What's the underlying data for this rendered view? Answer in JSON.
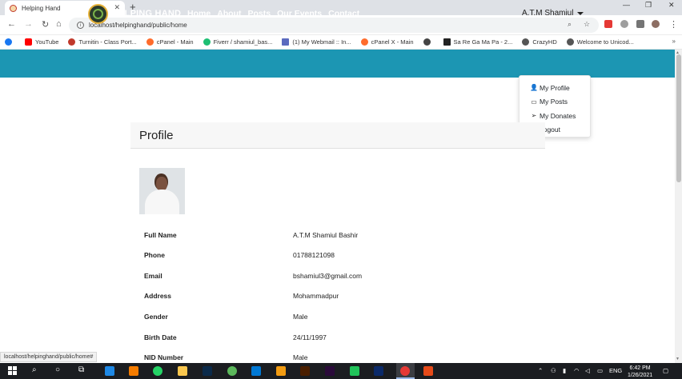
{
  "browser": {
    "tab_title": "Helping Hand",
    "url": "localhost/helpinghand/public/home",
    "status_url": "localhost/helpinghand/public/home#",
    "bookmarks": [
      {
        "label": "",
        "color": "#1877f2"
      },
      {
        "label": "YouTube",
        "color": "#ff0000"
      },
      {
        "label": "Turnitin - Class Port...",
        "color": "#c0392b"
      },
      {
        "label": "cPanel - Main",
        "color": "#ff6c2c"
      },
      {
        "label": "Fiverr / shamiul_bas...",
        "color": "#1dbf73"
      },
      {
        "label": "(1) My Webmail :: In...",
        "color": "#5b6abf"
      },
      {
        "label": "cPanel X - Main",
        "color": "#ff6c2c"
      },
      {
        "label": "",
        "color": "#444444"
      },
      {
        "label": "Sa Re Ga Ma Pa - 2...",
        "color": "#222222"
      },
      {
        "label": "CrazyHD",
        "color": "#555555"
      },
      {
        "label": "Welcome to Unicod...",
        "color": "#555555"
      }
    ]
  },
  "site": {
    "brand": "HELPING HAND",
    "nav": [
      "Home",
      "About",
      "Posts",
      "Our Events",
      "Contact"
    ],
    "user_name": "A.T.M Shamiul",
    "dropdown": [
      {
        "label": "My Profile",
        "icon": "user-icon"
      },
      {
        "label": "My Posts",
        "icon": "window-icon"
      },
      {
        "label": "My Donates",
        "icon": "paper-plane-icon"
      },
      {
        "label": "Logout",
        "icon": "lock-icon"
      }
    ]
  },
  "profile": {
    "title": "Profile",
    "fields": [
      {
        "label": "Full Name",
        "value": "A.T.M Shamiul Bashir"
      },
      {
        "label": "Phone",
        "value": "01788121098"
      },
      {
        "label": "Email",
        "value": "bshamiul3@gmail.com"
      },
      {
        "label": "Address",
        "value": "Mohammadpur"
      },
      {
        "label": "Gender",
        "value": "Male"
      },
      {
        "label": "Birth Date",
        "value": "24/11/1997"
      },
      {
        "label": "NID Number",
        "value": "Male"
      }
    ]
  },
  "taskbar": {
    "lang": "ENG",
    "time": "6:42 PM",
    "date": "1/26/2021"
  }
}
